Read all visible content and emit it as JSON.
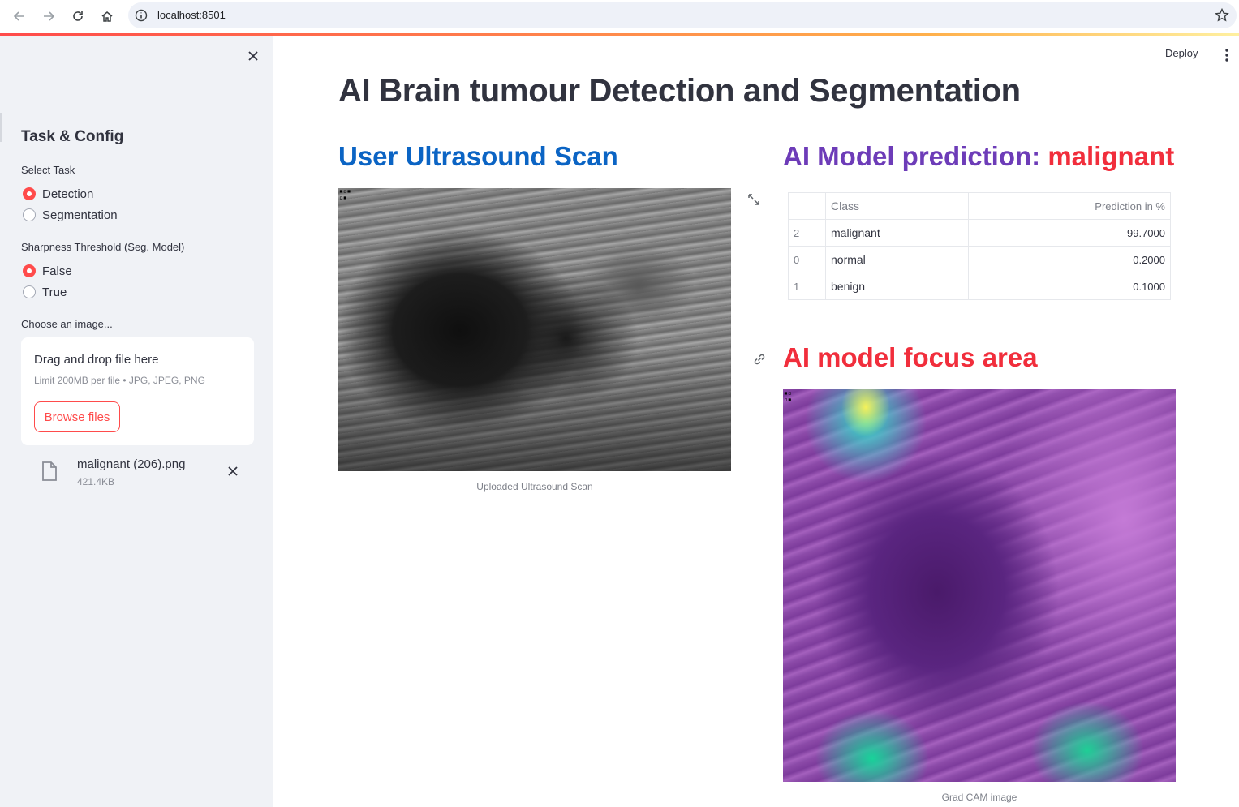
{
  "browser": {
    "url": "localhost:8501"
  },
  "sidebar": {
    "title": "Task & Config",
    "task_group": {
      "label": "Select Task",
      "options": [
        "Detection",
        "Segmentation"
      ],
      "selected": "Detection"
    },
    "threshold_group": {
      "label": "Sharpness Threshold (Seg. Model)",
      "options": [
        "False",
        "True"
      ],
      "selected": "False"
    },
    "uploader": {
      "label": "Choose an image...",
      "drop_text": "Drag and drop file here",
      "limit_text": "Limit 200MB per file • JPG, JPEG, PNG",
      "browse_label": "Browse files",
      "file_name": "malignant (206).png",
      "file_size": "421.4KB"
    }
  },
  "toolbar": {
    "deploy_label": "Deploy"
  },
  "main": {
    "title": "AI Brain tumour Detection and Segmentation",
    "scan_heading": "User Ultrasound Scan",
    "scan_caption": "Uploaded Ultrasound Scan",
    "prediction_heading_label": "AI Model prediction:",
    "prediction_heading_value": "malignant",
    "focus_heading": "AI model focus area",
    "gradcam_caption": "Grad CAM image",
    "table": {
      "columns": [
        "",
        "Class",
        "Prediction in %"
      ],
      "rows": [
        {
          "index": "2",
          "class": "malignant",
          "prediction": "99.7000"
        },
        {
          "index": "0",
          "class": "normal",
          "prediction": "0.2000"
        },
        {
          "index": "1",
          "class": "benign",
          "prediction": "0.1000"
        }
      ]
    }
  },
  "colors": {
    "accent": "#ff4b4b",
    "scan_heading": "#0b64c4",
    "prediction_label": "#6d3cb8",
    "prediction_value": "#f12e3c",
    "sidebar_bg": "#f0f2f6"
  },
  "icons": {
    "back": "arrow-left-icon",
    "forward": "arrow-right-icon",
    "reload": "reload-icon",
    "home": "home-icon",
    "info": "info-icon",
    "bookmark": "star-icon",
    "sidebar_close": "close-icon",
    "file": "file-icon",
    "file_remove": "close-icon",
    "menu": "kebab-menu-icon",
    "expand": "expand-icon",
    "anchor": "link-icon"
  }
}
